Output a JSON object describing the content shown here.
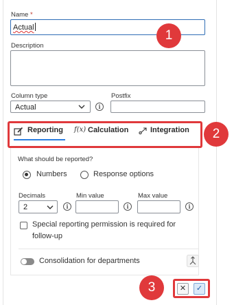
{
  "form": {
    "name_label": "Name",
    "required_mark": "*",
    "name_value": "Actual",
    "description_label": "Description",
    "description_value": "",
    "column_type_label": "Column type",
    "column_type_value": "Actual",
    "postfix_label": "Postfix",
    "postfix_value": ""
  },
  "tabs": [
    {
      "label": "Reporting",
      "icon": "pencil-square-icon",
      "active": true
    },
    {
      "label": "Calculation",
      "icon": "function-icon",
      "active": false
    },
    {
      "label": "Integration",
      "icon": "integration-icon",
      "active": false
    }
  ],
  "reporting": {
    "question": "What should be reported?",
    "option_numbers": "Numbers",
    "option_response": "Response options",
    "selected_option": "Numbers",
    "decimals_label": "Decimals",
    "decimals_value": "2",
    "min_label": "Min value",
    "min_value": "",
    "max_label": "Max value",
    "max_value": "",
    "special_permission": "Special reporting permission is required for follow-up",
    "special_permission_line1": "Special reporting permission is required for",
    "special_permission_line2": "follow-up",
    "special_permission_checked": false,
    "consolidation_label": "Consolidation for departments",
    "consolidation_on": false
  },
  "callouts": [
    "1",
    "2",
    "3"
  ],
  "footer": {
    "cancel_symbol": "✕",
    "confirm_symbol": "✓"
  },
  "colors": {
    "accent": "#2a7de1",
    "callout": "#e0393b",
    "focus_border": "#2f6db5"
  }
}
